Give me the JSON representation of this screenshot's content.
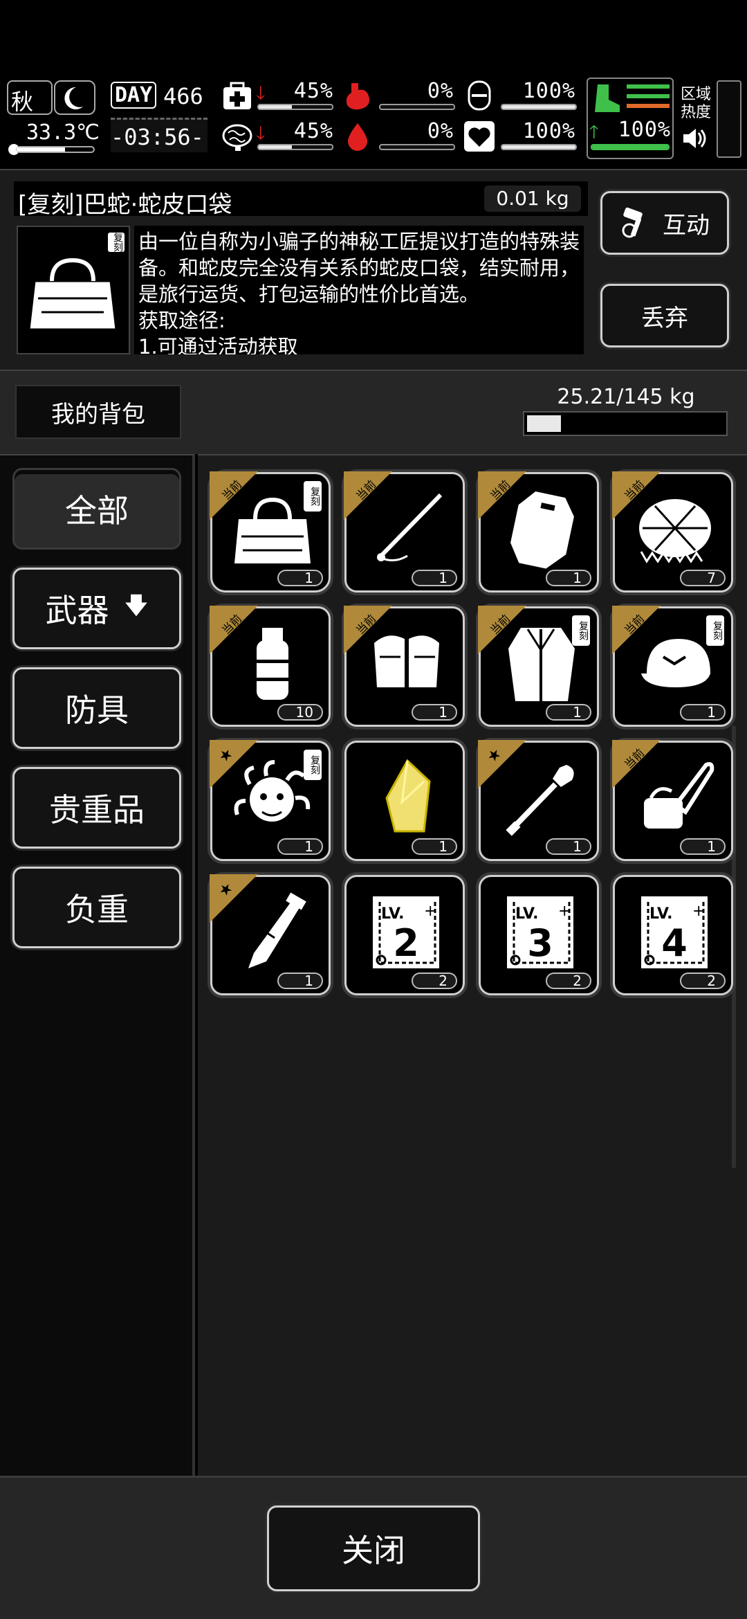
{
  "status_bar": {
    "season": "秋",
    "temperature": "33.3℃",
    "day_label": "DAY",
    "day_number": "466",
    "clock": "-03:56-",
    "region_label": "区域\n热度",
    "stats": {
      "health": {
        "value": "45%",
        "level": 0.45
      },
      "brain": {
        "value": "45%",
        "level": 0.45
      },
      "hunger": {
        "value": "0%",
        "level": 0.0
      },
      "thirst": {
        "value": "0%",
        "level": 0.0
      },
      "toilet": {
        "value": "100%",
        "level": 1.0
      },
      "mood": {
        "value": "100%",
        "level": 1.0
      },
      "stamina": {
        "value": "100%",
        "level": 1.0
      }
    }
  },
  "item_detail": {
    "name": "[复刻]巴蛇·蛇皮口袋",
    "weight": "0.01 kg",
    "tag": "复刻",
    "description": "由一位自称为小骗子的神秘工匠提议打造的特殊装备。和蛇皮完全没有关系的蛇皮口袋，结实耐用，是旅行运货、打包运输的性价比首选。\n获取途径:\n1.可通过活动获取"
  },
  "actions": {
    "interact_label": "互动",
    "discard_label": "丢弃"
  },
  "bag": {
    "title": "我的背包",
    "weight_text": "25.21/145 kg",
    "weight_fraction": 0.174
  },
  "categories": [
    {
      "label": "全部",
      "active": true
    },
    {
      "label": "武器",
      "arrow": "🡇"
    },
    {
      "label": "防具"
    },
    {
      "label": "贵重品"
    },
    {
      "label": "负重"
    }
  ],
  "items": [
    {
      "name": "snake-bag",
      "count": "1",
      "ribbon": "当前",
      "tag": "复刻",
      "selected": true
    },
    {
      "name": "spear",
      "count": "1",
      "ribbon": "当前"
    },
    {
      "name": "riot-shield",
      "count": "1",
      "ribbon": "当前"
    },
    {
      "name": "turtle-shell",
      "count": "7",
      "ribbon": "当前"
    },
    {
      "name": "grenade",
      "count": "10",
      "ribbon": "当前"
    },
    {
      "name": "gloves",
      "count": "1",
      "ribbon": "当前"
    },
    {
      "name": "coat",
      "count": "1",
      "ribbon": "当前",
      "tag": "复刻"
    },
    {
      "name": "cap",
      "count": "1",
      "ribbon": "当前",
      "tag": "复刻"
    },
    {
      "name": "medusa-head",
      "count": "1",
      "star": true,
      "tag": "复刻"
    },
    {
      "name": "yellow-crystal",
      "count": "1"
    },
    {
      "name": "shovel",
      "count": "1",
      "star": true
    },
    {
      "name": "chainsaw",
      "count": "1",
      "ribbon": "当前"
    },
    {
      "name": "machete",
      "count": "1",
      "star": true
    },
    {
      "name": "lv2-book",
      "count": "2",
      "level": "2"
    },
    {
      "name": "lv3-book",
      "count": "2",
      "level": "3"
    },
    {
      "name": "lv4-book",
      "count": "2",
      "level": "4"
    }
  ],
  "close_label": "关闭",
  "icons": {
    "level_prefix": "LV."
  }
}
